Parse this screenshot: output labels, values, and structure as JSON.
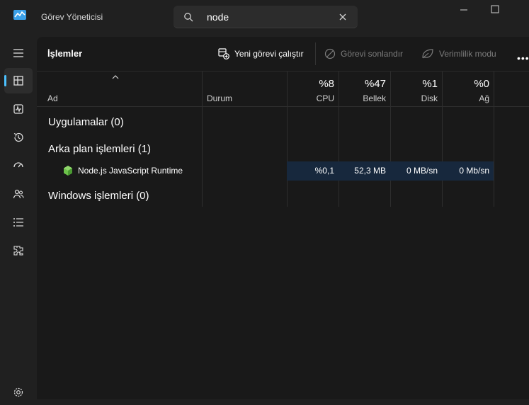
{
  "app": {
    "title": "Görev Yöneticisi"
  },
  "search": {
    "value": "node"
  },
  "header": {
    "title": "İşlemler",
    "new_task": "Yeni görevi çalıştır",
    "end_task": "Görevi sonlandır",
    "efficiency": "Verimlilik modu",
    "more": "•••"
  },
  "columns": {
    "name": "Ad",
    "status": "Durum",
    "cpu": {
      "pct": "%8",
      "label": "CPU"
    },
    "memory": {
      "pct": "%47",
      "label": "Bellek"
    },
    "disk": {
      "pct": "%1",
      "label": "Disk"
    },
    "network": {
      "pct": "%0",
      "label": "Ağ"
    }
  },
  "groups": {
    "apps": "Uygulamalar (0)",
    "background": "Arka plan işlemleri (1)",
    "windows": "Windows işlemleri (0)"
  },
  "process": {
    "name": "Node.js JavaScript Runtime",
    "cpu": "%0,1",
    "memory": "52,3 MB",
    "disk": "0 MB/sn",
    "network": "0 Mb/sn"
  },
  "colors": {
    "accent": "#4cc2ff",
    "selected_row": "#17283d",
    "node_green": "#6cc24a"
  }
}
